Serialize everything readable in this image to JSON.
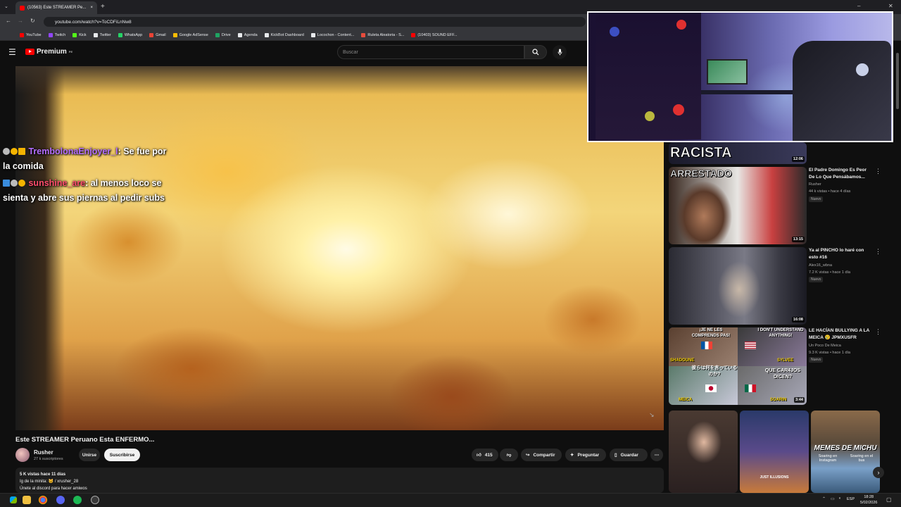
{
  "browser": {
    "tab_title": "(10563) Este STREAMER Pe...",
    "url": "youtube.com/watch?v=ToCDFiLnNw8",
    "bookmarks": [
      {
        "label": "YouTube",
        "color": "#ff0000"
      },
      {
        "label": "Twitch",
        "color": "#9146ff"
      },
      {
        "label": "Kick",
        "color": "#53fc18"
      },
      {
        "label": "Twitter",
        "color": "#e8eaed"
      },
      {
        "label": "WhatsApp",
        "color": "#25d366"
      },
      {
        "label": "Gmail",
        "color": "#ea4335"
      },
      {
        "label": "Google AdSense",
        "color": "#fbbc04"
      },
      {
        "label": "Drive",
        "color": "#1fa463"
      },
      {
        "label": "Agenda",
        "color": "#e8eaed"
      },
      {
        "label": "KickBot Dashboard",
        "color": "#e8eaed"
      },
      {
        "label": "Locochon - Content...",
        "color": "#e8eaed"
      },
      {
        "label": "Ruleta Aleatoria - S...",
        "color": "#e74c3c"
      },
      {
        "label": "(10403) SOUND EFF...",
        "color": "#ff0000"
      }
    ]
  },
  "header": {
    "logo_text": "Premium",
    "logo_sup": "PE",
    "search_placeholder": "Buscar"
  },
  "chat": [
    {
      "user": "TrembolonaEnjoyer_l",
      "message": ": Se fue por la comida"
    },
    {
      "user": "sunshine_are",
      "message": ": al menos loco se sienta y abre sus piernas al pedir subs"
    }
  ],
  "video": {
    "title": "Este STREAMER Peruano Esta ENFERMO...",
    "channel": "Rusher",
    "subscribers": "27 k suscriptores",
    "join_label": "Unirse",
    "subscribe_label": "Suscribirse",
    "likes": "415",
    "share_label": "Compartir",
    "ask_label": "Preguntar",
    "save_label": "Guardar",
    "description": {
      "stats": "5 K vistas  hace 11 días",
      "line1": "Ig de la minita: 🐱 / xrusher_28",
      "line2": "Únete al discord para hacer amiwos"
    }
  },
  "sidebar": {
    "videos": [
      {
        "overlay": "RACISTA",
        "duration": "12:06"
      },
      {
        "overlay": "ARRESTADO",
        "duration": "13:15",
        "title": "El Padre Domingo Es Peor De Lo Que Pensábamos...",
        "channel": "Rusher",
        "meta": "44 k vistas • hace 4 días",
        "badge": "Nuevo"
      },
      {
        "duration": "16:08",
        "title": "Ya al PINCHO lo haré con esto #16",
        "channel": "Alex16_wbna",
        "meta": "7.2 K vistas • hace 1 día",
        "badge": "Nuevo"
      },
      {
        "duration": "3:44",
        "title": "LE HACÍAN BULLYING A LA MEICA 😢 JPMXUSFR",
        "channel": "Un Poco De Meica",
        "meta": "9.3 K vistas • hace 1 día",
        "badge": "Nuevo",
        "captions": [
          "¡JE NE LES COMPRENDS PAS!",
          "I DON'T UNDERSTAND ANYTHING!",
          "彼らは何を言っているのか?",
          "QUE CAR4JOS DICEN?"
        ],
        "names": [
          "SHADOUNE",
          "SYLVEE",
          "MEICA",
          "SOARIN"
        ]
      }
    ],
    "shorts": [
      {
        "caption": ""
      },
      {
        "caption": "JUST ILLUSIONS"
      },
      {
        "caption": "MEMES DE MICHU",
        "sub1": "Soaring en Instagram",
        "sub2": "Soaring en el bus"
      }
    ]
  },
  "taskbar": {
    "time": "18:28",
    "date": "5/02/2026",
    "lang": "ESP"
  }
}
